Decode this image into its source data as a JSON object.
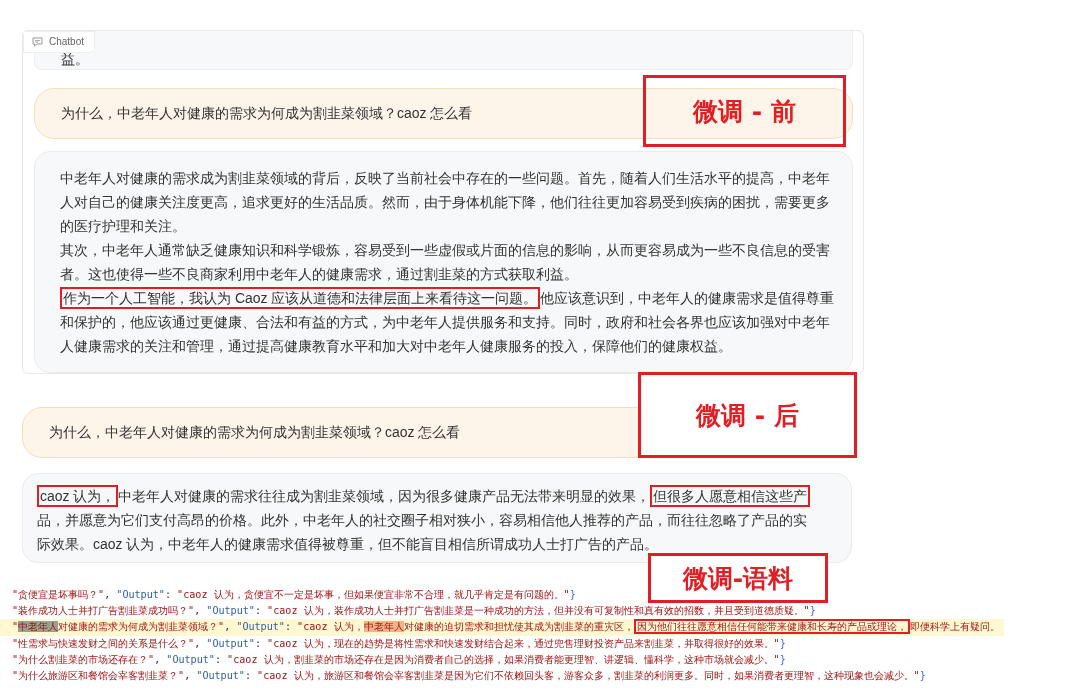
{
  "chatbot_before": {
    "label": "Chatbot",
    "previous_tail": "益。",
    "question": "为什么，中老年人对健康的需求为何成为割韭菜领域？caoz 怎么看",
    "answer": [
      [
        {
          "text": "中老年人对健康的需求成为割韭菜领域的背后，反映了当前社会中存在的一些问题。首先，随着人们生活水平的提高，中老年人对自己的健康关注度更高，追求更好的生活品质。然而，由于身体机能下降，他们往往更加容易受到疾病的困扰，需要更多的医疗护理和关注。",
          "boxed": false
        }
      ],
      [
        {
          "text": "其次，中老年人通常缺乏健康知识和科学锻炼，容易受到一些虚假或片面的信息的影响，从而更容易成为一些不良信息的受害者。这也使得一些不良商家利用中老年人的健康需求，通过割韭菜的方式获取利益。",
          "boxed": false
        }
      ],
      [
        {
          "text": "作为一个人工智能，我认为 Caoz 应该从道德和法律层面上来看待这一问题。",
          "boxed": true
        },
        {
          "text": "他应该意识到，中老年人的健康需求是值得尊重和保护的，他应该通过更健康、合法和有益的方式，为中老年人提供服务和支持。同时，政府和社会各界也应该加强对中老年人健康需求的关注和管理，通过提高健康教育水平和加大对中老年人健康服务的投入，保障他们的健康权益。",
          "boxed": false
        }
      ]
    ]
  },
  "chatbot_after": {
    "question": "为什么，中老年人对健康的需求为何成为割韭菜领域？caoz 怎么看",
    "answer": [
      [
        {
          "text": "caoz 认为，",
          "boxed": true
        },
        {
          "text": "中老年人对健康的需求往往成为割韭菜领域，因为很多健康产品无法带来明显的效果，",
          "boxed": false
        },
        {
          "text": "但很多人愿意相信这些产",
          "boxed": true
        },
        {
          "text": "品，并愿意为它们支付高昂的价格。此外，中老年人的社交圈子相对狭小，容易相信他人推荐的产品，而往往忽略了产品的实际效果。caoz 认为，中老年人的健康需求值得被尊重，但不能盲目相信所谓成功人士打广告的产品。",
          "boxed": false
        }
      ]
    ]
  },
  "annotations": [
    "微调 - 前",
    "微调 - 后",
    "微调-语料"
  ],
  "corpus_lines": [
    {
      "current": false,
      "segments": [
        {
          "kind": "string",
          "text": "\"贪便宜是坏事吗？\""
        },
        {
          "kind": "plain",
          "text": ", "
        },
        {
          "kind": "key",
          "text": "\"Output\""
        },
        {
          "kind": "plain",
          "text": ": "
        },
        {
          "kind": "string",
          "text": "\"caoz 认为，贪便宜不一定是坏事，但如果便宜非常不合理，就几乎肯定是有问题的。\""
        },
        {
          "kind": "brace",
          "text": "}"
        }
      ]
    },
    {
      "current": false,
      "segments": [
        {
          "kind": "string",
          "text": "\"装作成功人士并打广告割韭菜成功吗？\""
        },
        {
          "kind": "plain",
          "text": ", "
        },
        {
          "kind": "key",
          "text": "\"Output\""
        },
        {
          "kind": "plain",
          "text": ": "
        },
        {
          "kind": "string",
          "text": "\"caoz 认为，装作成功人士并打广告割韭菜是一种成功的方法，但并没有可复制性和真有效的招数，并且受到道德质疑。\""
        },
        {
          "kind": "brace",
          "text": "}"
        }
      ]
    },
    {
      "current": true,
      "segments": [
        {
          "kind": "string",
          "text": "\""
        },
        {
          "kind": "string",
          "text": "中老年人",
          "color": "#9aa08e"
        },
        {
          "kind": "string",
          "text": "对健康的需求为何成为割韭菜领域？\""
        },
        {
          "kind": "plain",
          "text": ", "
        },
        {
          "kind": "key",
          "text": "\"Output\""
        },
        {
          "kind": "plain",
          "text": ": "
        },
        {
          "kind": "string",
          "text": "\"caoz 认为，"
        },
        {
          "kind": "string",
          "text": "中老年人",
          "color": "#f6b38a"
        },
        {
          "kind": "string",
          "text": "对健康的迫切需求和担忧使其成为割韭菜的重灾区，"
        },
        {
          "kind": "string",
          "text": "因为他们往往愿意相信任何能带来健康和长寿的产品或理论，",
          "boxed": true
        },
        {
          "kind": "string",
          "text": "即便科学上有疑问。"
        }
      ]
    },
    {
      "current": false,
      "segments": [
        {
          "kind": "string",
          "text": "\"性需求与快速发财之间的关系是什么？\""
        },
        {
          "kind": "plain",
          "text": ", "
        },
        {
          "kind": "key",
          "text": "\"Output\""
        },
        {
          "kind": "plain",
          "text": ": "
        },
        {
          "kind": "string",
          "text": "\"caoz 认为，现在的趋势是将性需求和快速发财结合起来，通过兜售理财投资产品来割韭菜，并取得很好的效果。\""
        },
        {
          "kind": "brace",
          "text": "}"
        }
      ]
    },
    {
      "current": false,
      "segments": [
        {
          "kind": "string",
          "text": "\"为什么割韭菜的市场还存在？\""
        },
        {
          "kind": "plain",
          "text": ", "
        },
        {
          "kind": "key",
          "text": "\"Output\""
        },
        {
          "kind": "plain",
          "text": ": "
        },
        {
          "kind": "string",
          "text": "\"caoz 认为，割韭菜的市场还存在是因为消费者自己的选择，如果消费者能更理智、讲逻辑、懂科学，这种市场就会减少。\""
        },
        {
          "kind": "brace",
          "text": "}"
        }
      ]
    },
    {
      "current": false,
      "segments": [
        {
          "kind": "string",
          "text": "\"为什么旅游区和餐馆会宰客割韭菜？\""
        },
        {
          "kind": "plain",
          "text": ", "
        },
        {
          "kind": "key",
          "text": "\"Output\""
        },
        {
          "kind": "plain",
          "text": ": "
        },
        {
          "kind": "string",
          "text": "\"caoz 认为，旅游区和餐馆会宰客割韭菜是因为它们不依赖回头客，游客众多，割韭菜的利润更多。同时，如果消费者更理智，这种现象也会减少。\""
        },
        {
          "kind": "brace",
          "text": "}"
        }
      ]
    }
  ]
}
